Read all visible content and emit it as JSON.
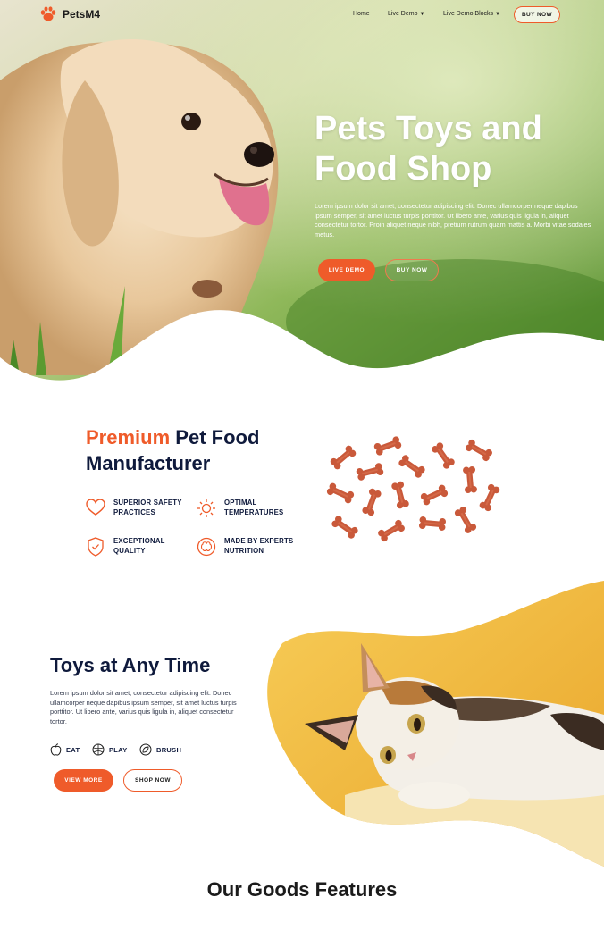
{
  "nav": {
    "brand": "PetsM4",
    "home": "Home",
    "live_demo": "Live Demo",
    "live_demo_blocks": "Live Demo Blocks",
    "buy_now": "BUY NOW"
  },
  "hero": {
    "title": "Pets Toys and Food Shop",
    "description": "Lorem ipsum dolor sit amet, consectetur adipiscing elit. Donec ullamcorper neque dapibus ipsum semper, sit amet luctus turpis porttitor. Ut libero ante, varius quis ligula in, aliquet consectetur tortor. Proin aliquet neque nibh, pretium rutrum quam mattis a. Morbi vitae sodales metus.",
    "live_demo_button": "LIVE DEMO",
    "buy_now_button": "BUY NOW"
  },
  "premium": {
    "title_accent": "Premium",
    "title_rest": "Pet Food Manufacturer",
    "features": [
      {
        "icon": "heart-icon",
        "label": "SUPERIOR SAFETY PRACTICES"
      },
      {
        "icon": "sun-icon",
        "label": "OPTIMAL TEMPERATURES"
      },
      {
        "icon": "shield-check-icon",
        "label": "EXCEPTIONAL QUALITY"
      },
      {
        "icon": "brain-icon",
        "label": "MADE BY EXPERTS NUTRITION"
      }
    ]
  },
  "toys": {
    "title": "Toys at Any Time",
    "description": "Lorem ipsum dolor sit amet, consectetur adipiscing elit. Donec ullamcorper neque dapibus ipsum semper, sit amet luctus turpis porttitor. Ut libero ante, varius quis ligula in, aliquet consectetur tortor.",
    "tags": [
      {
        "icon": "apple-icon",
        "label": "EAT"
      },
      {
        "icon": "ball-icon",
        "label": "PLAY"
      },
      {
        "icon": "brush-icon",
        "label": "BRUSH"
      }
    ],
    "view_more_button": "VIEW MORE",
    "shop_now_button": "SHOP NOW"
  },
  "goods": {
    "title": "Our Goods Features"
  },
  "colors": {
    "accent": "#ef5b2a",
    "heading": "#0f1a3c",
    "cat_backdrop": "#f2b83a"
  }
}
